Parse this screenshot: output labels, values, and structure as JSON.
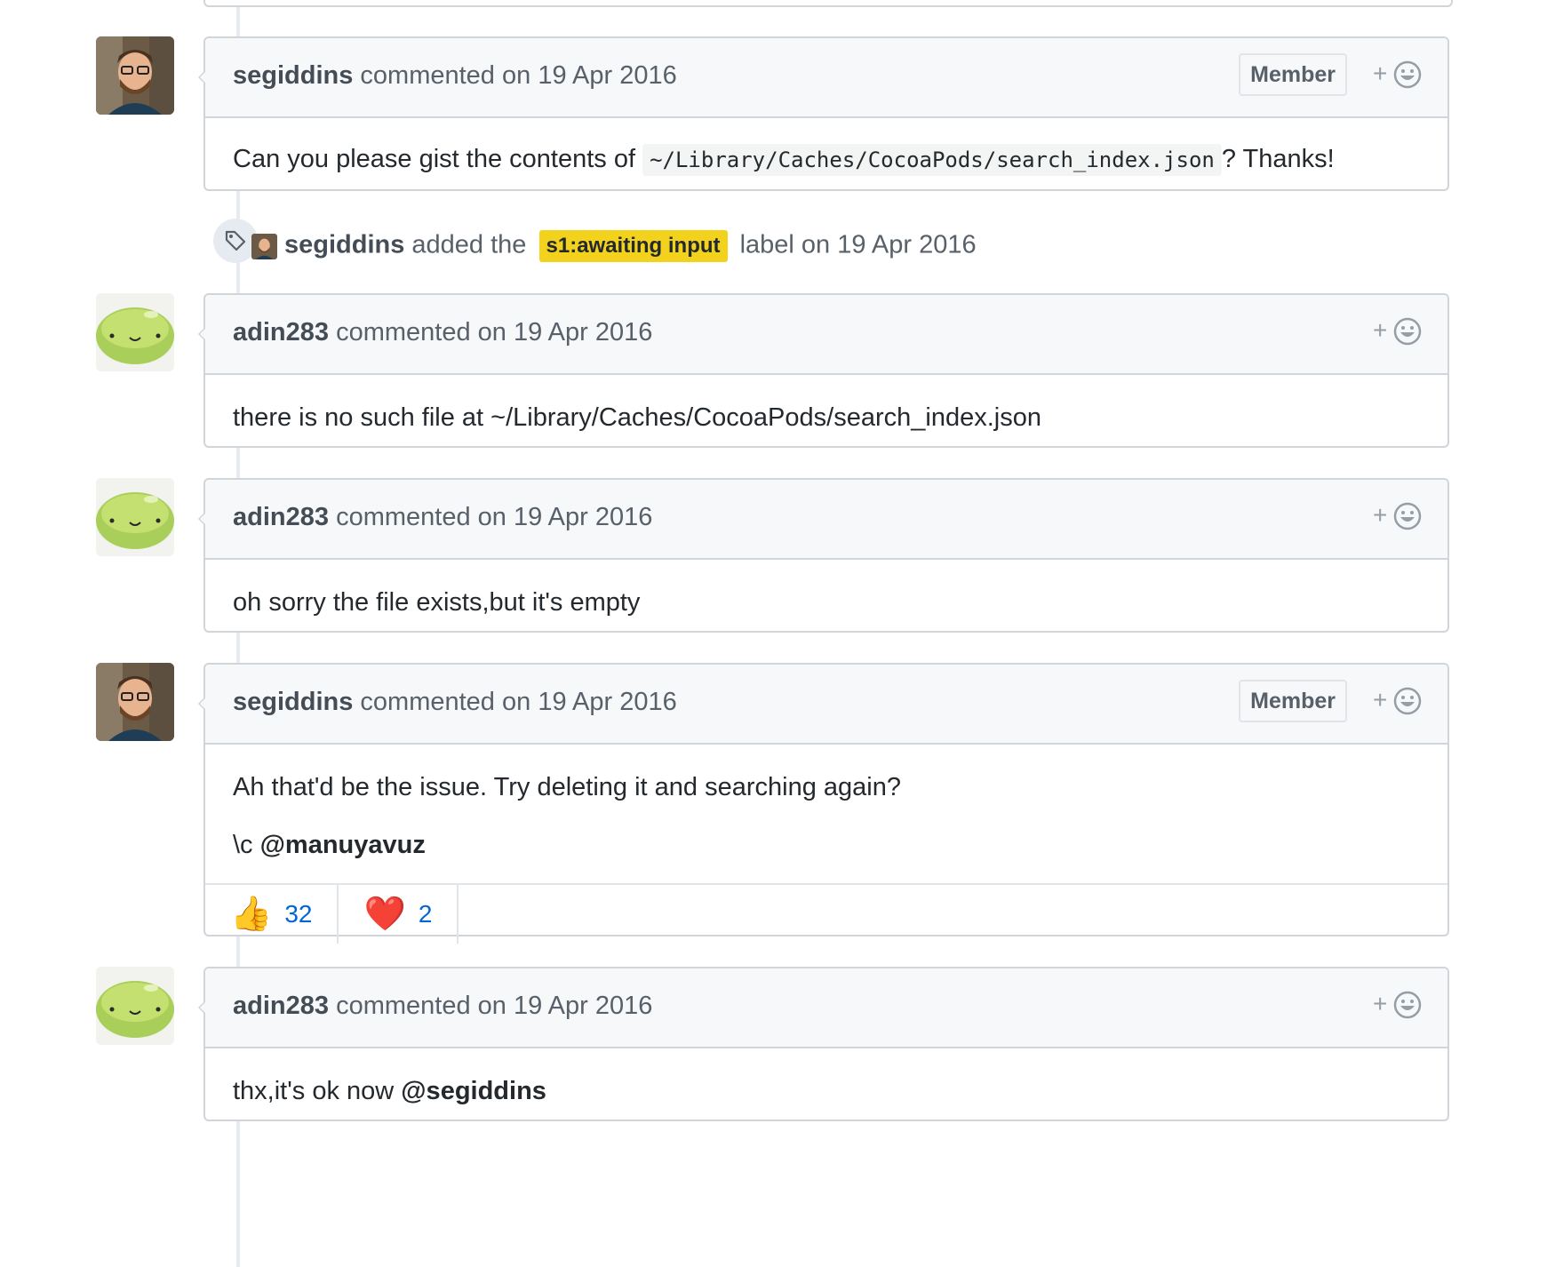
{
  "timeline": [
    {
      "type": "comment",
      "author": "segiddins",
      "action": "commented",
      "date": "on 19 Apr 2016",
      "badge": "Member",
      "body": {
        "before": "Can you please gist the contents of ",
        "code": "~/Library/Caches/CocoaPods/search_index.json",
        "after": "? Thanks!"
      }
    },
    {
      "type": "label-event",
      "author": "segiddins",
      "before": "added the",
      "label": "s1:awaiting input",
      "label_color": "#f2d21d",
      "after": "label on 19 Apr 2016",
      "icon": "tag-icon"
    },
    {
      "type": "comment",
      "author": "adin283",
      "action": "commented",
      "date": "on 19 Apr 2016",
      "body": "there is no such file at ~/Library/Caches/CocoaPods/search_index.json"
    },
    {
      "type": "comment",
      "author": "adin283",
      "action": "commented",
      "date": "on 19 Apr 2016",
      "body": "oh sorry the file exists,but it's empty"
    },
    {
      "type": "comment",
      "author": "segiddins",
      "action": "commented",
      "date": "on 19 Apr 2016",
      "badge": "Member",
      "body": {
        "line1": "Ah that'd be the issue. Try deleting it and searching again?",
        "line2_prefix": "\\c ",
        "line2_mention": "@manuyavuz"
      },
      "reactions": [
        {
          "emoji": "👍",
          "count": "32",
          "name": "thumbs-up"
        },
        {
          "emoji": "❤️",
          "count": "2",
          "name": "heart"
        }
      ]
    },
    {
      "type": "comment",
      "author": "adin283",
      "action": "commented",
      "date": "on 19 Apr 2016",
      "body": {
        "text": "thx,it's ok now ",
        "mention": "@segiddins"
      }
    }
  ],
  "reaction_button": {
    "plus": "+",
    "icon": "smiley-icon"
  },
  "colors": {
    "link": "#0366d6",
    "header_bg": "#f6f8fa",
    "border": "#d1d5da",
    "label": "#f2d21d"
  }
}
